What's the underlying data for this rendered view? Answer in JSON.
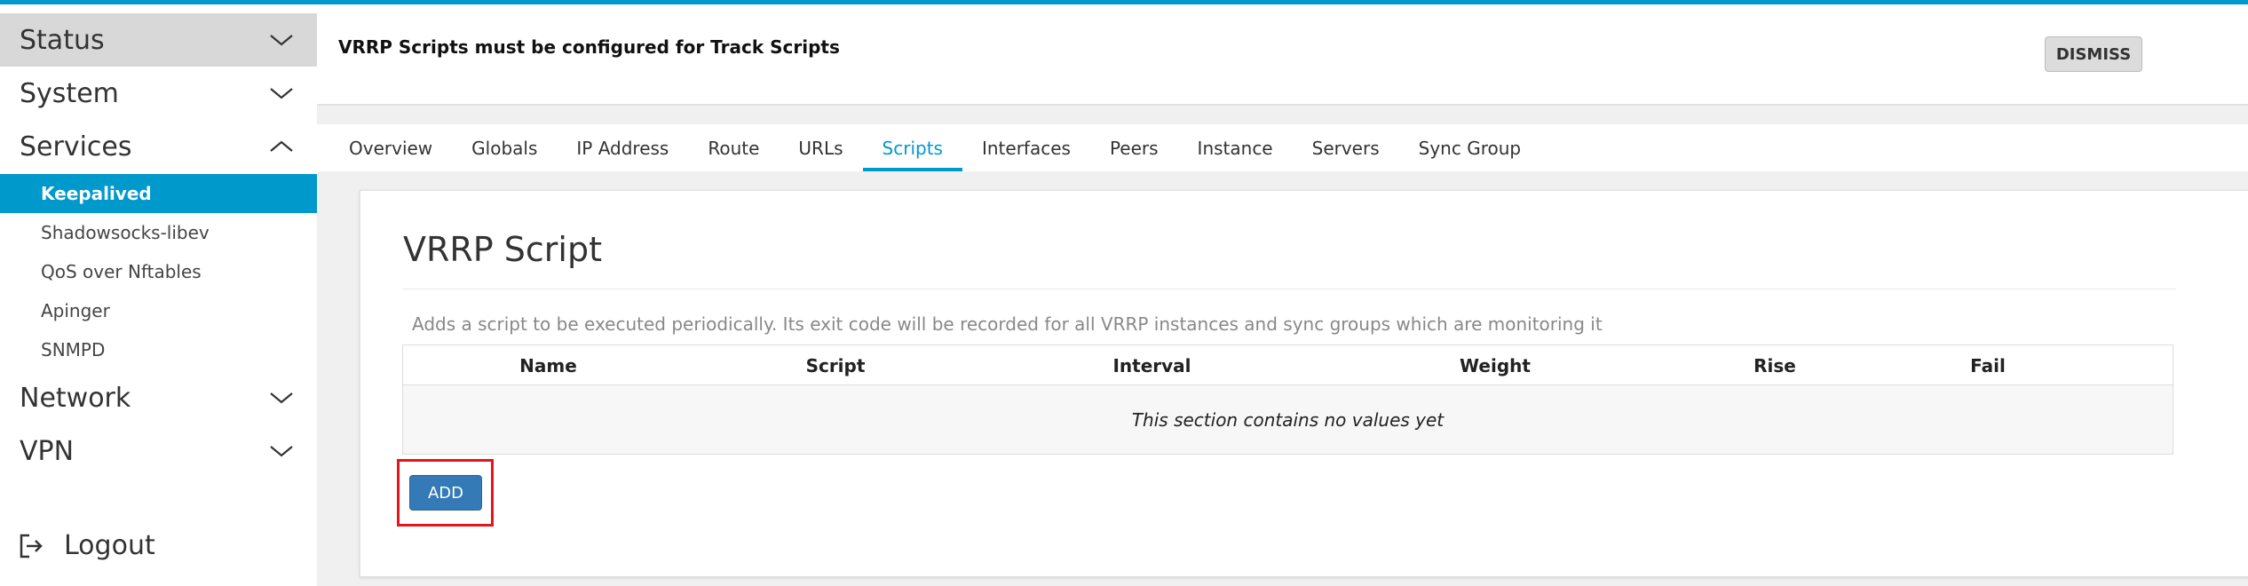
{
  "sidebar": {
    "items": [
      {
        "label": "Status",
        "icon": "chevron-down-icon"
      },
      {
        "label": "System",
        "icon": "chevron-down-icon"
      },
      {
        "label": "Services",
        "icon": "chevron-up-icon"
      },
      {
        "label": "Network",
        "icon": "chevron-down-icon"
      },
      {
        "label": "VPN",
        "icon": "chevron-down-icon"
      }
    ],
    "services_sub": [
      "Keepalived",
      "Shadowsocks-libev",
      "QoS over Nftables",
      "Apinger",
      "SNMPD"
    ],
    "logout": "Logout"
  },
  "alert": {
    "text": "VRRP Scripts must be configured for Track Scripts",
    "dismiss": "DISMISS"
  },
  "tabs": [
    "Overview",
    "Globals",
    "IP Address",
    "Route",
    "URLs",
    "Scripts",
    "Interfaces",
    "Peers",
    "Instance",
    "Servers",
    "Sync Group"
  ],
  "card": {
    "title": "VRRP Script",
    "description": "Adds a script to be executed periodically. Its exit code will be recorded for all VRRP instances and sync groups which are monitoring it",
    "columns": [
      "Name",
      "Script",
      "Interval",
      "Weight",
      "Rise",
      "Fail"
    ],
    "empty": "This section contains no values yet",
    "add": "ADD"
  },
  "colors": {
    "accent": "#0099cc",
    "button_primary": "#337ab7",
    "highlight": "#e2161c"
  }
}
